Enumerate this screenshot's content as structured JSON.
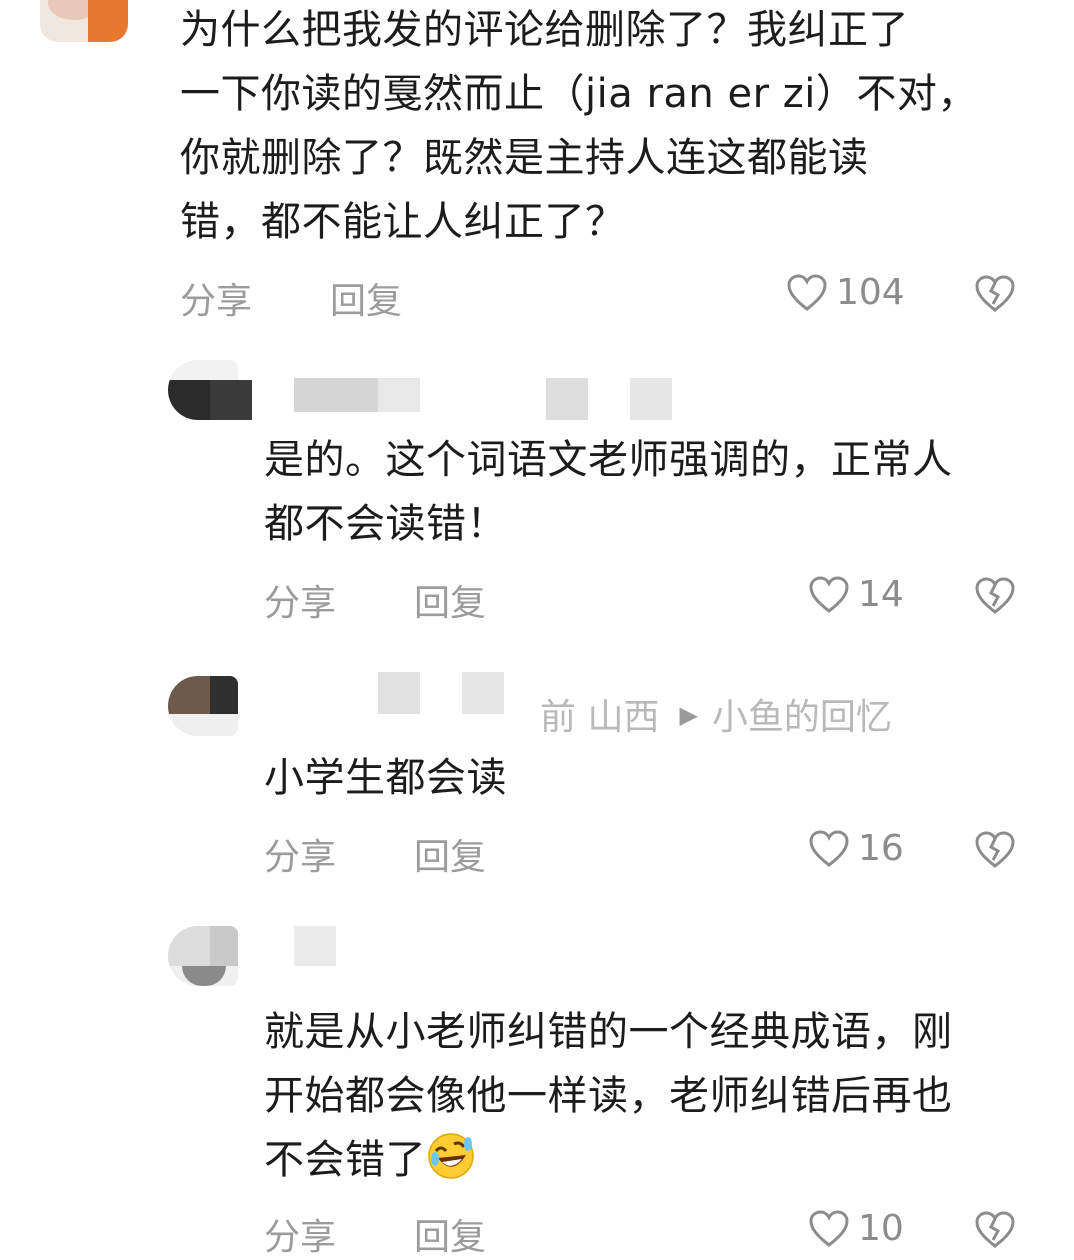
{
  "colors": {
    "text": "#1c1c1c",
    "muted": "#9c9c9c",
    "meta": "#b9b9b9",
    "avatar_orange": "#e9782f"
  },
  "actions": {
    "share_label": "分享",
    "reply_label": "回复"
  },
  "icons": {
    "like": "heart-outline-icon",
    "dislike": "broken-heart-icon",
    "emoji": "rolling-on-floor-laughing-emoji",
    "reply_arrow": "triangle-right-icon"
  },
  "comments": [
    {
      "lines": [
        "为什么把我发的评论给删除了？我纠正了",
        "一下你读的戛然而止（jia ran er zi）不对，",
        "你就删除了？既然是主持人连这都能读",
        "错，都不能让人纠正了？"
      ],
      "likes": "104"
    },
    {
      "lines": [
        "是的。这个词语文老师强调的，正常人",
        "都不会读错！"
      ],
      "likes": "14"
    },
    {
      "meta": {
        "time_location": "前 山西",
        "reply_to": "小鱼的回忆"
      },
      "lines": [
        "小学生都会读"
      ],
      "likes": "16"
    },
    {
      "lines": [
        "就是从小老师纠错的一个经典成语，刚",
        "开始都会像他一样读，老师纠错后再也",
        "不会错了"
      ],
      "likes": "10"
    }
  ]
}
